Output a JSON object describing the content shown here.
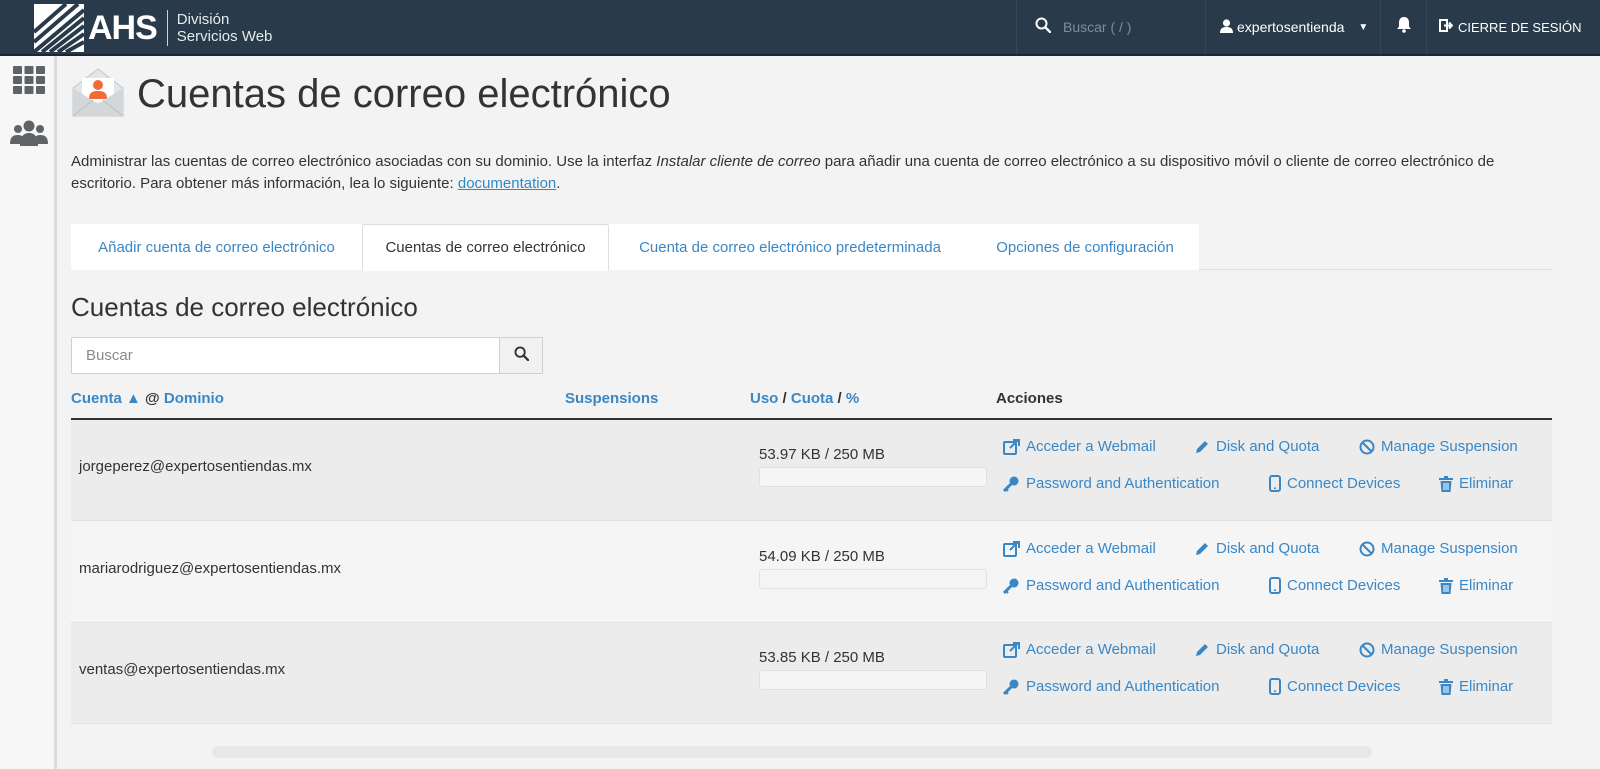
{
  "header": {
    "logo_text": "AHS",
    "logo_sub_line1": "División",
    "logo_sub_line2": "Servicios Web",
    "search_placeholder": "Buscar ( / )",
    "username": "expertosentienda",
    "logout_label": "CIERRE DE SESIÓN"
  },
  "page": {
    "title": "Cuentas de correo electrónico",
    "description_part1": "Administrar las cuentas de correo electrónico asociadas con su dominio. Use la interfaz ",
    "description_em": "Instalar cliente de correo",
    "description_part2": " para añadir una cuenta de correo electrónico a su dispositivo móvil o cliente de correo electrónico de escritorio. Para obtener más información, lea lo siguiente: ",
    "description_link": "documentation",
    "description_end": "."
  },
  "tabs": [
    {
      "label": "Añadir cuenta de correo electrónico",
      "active": false
    },
    {
      "label": "Cuentas de correo electrónico",
      "active": true
    },
    {
      "label": "Cuenta de correo electrónico predeterminada",
      "active": false
    },
    {
      "label": "Opciones de configuración",
      "active": false
    }
  ],
  "section": {
    "title": "Cuentas de correo electrónico",
    "search_placeholder": "Buscar"
  },
  "table": {
    "col_cuenta": "Cuenta",
    "sort_indicator": "▲",
    "at": "@",
    "col_dominio": "Dominio",
    "col_suspensions": "Suspensions",
    "col_uso": "Uso",
    "slash1": "/",
    "col_cuota": "Cuota",
    "slash2": "/",
    "col_pct": "%",
    "col_acciones": "Acciones"
  },
  "actions": {
    "webmail": "Acceder a Webmail",
    "disk": "Disk and Quota",
    "suspension": "Manage Suspension",
    "password": "Password and Authentication",
    "devices": "Connect Devices",
    "delete": "Eliminar"
  },
  "accounts": [
    {
      "email": "jorgeperez@expertosentiendas.mx",
      "usage": "53.97 KB / 250 MB",
      "usage_fraction": 0.0002
    },
    {
      "email": "mariarodriguez@expertosentiendas.mx",
      "usage": "54.09 KB / 250 MB",
      "usage_fraction": 0.0002
    },
    {
      "email": "ventas@expertosentiendas.mx",
      "usage": "53.85 KB / 250 MB",
      "usage_fraction": 0.0002
    }
  ],
  "colors": {
    "topbar": "#293a4a",
    "link": "#3a87c6",
    "accent_orange": "#f26a36"
  }
}
